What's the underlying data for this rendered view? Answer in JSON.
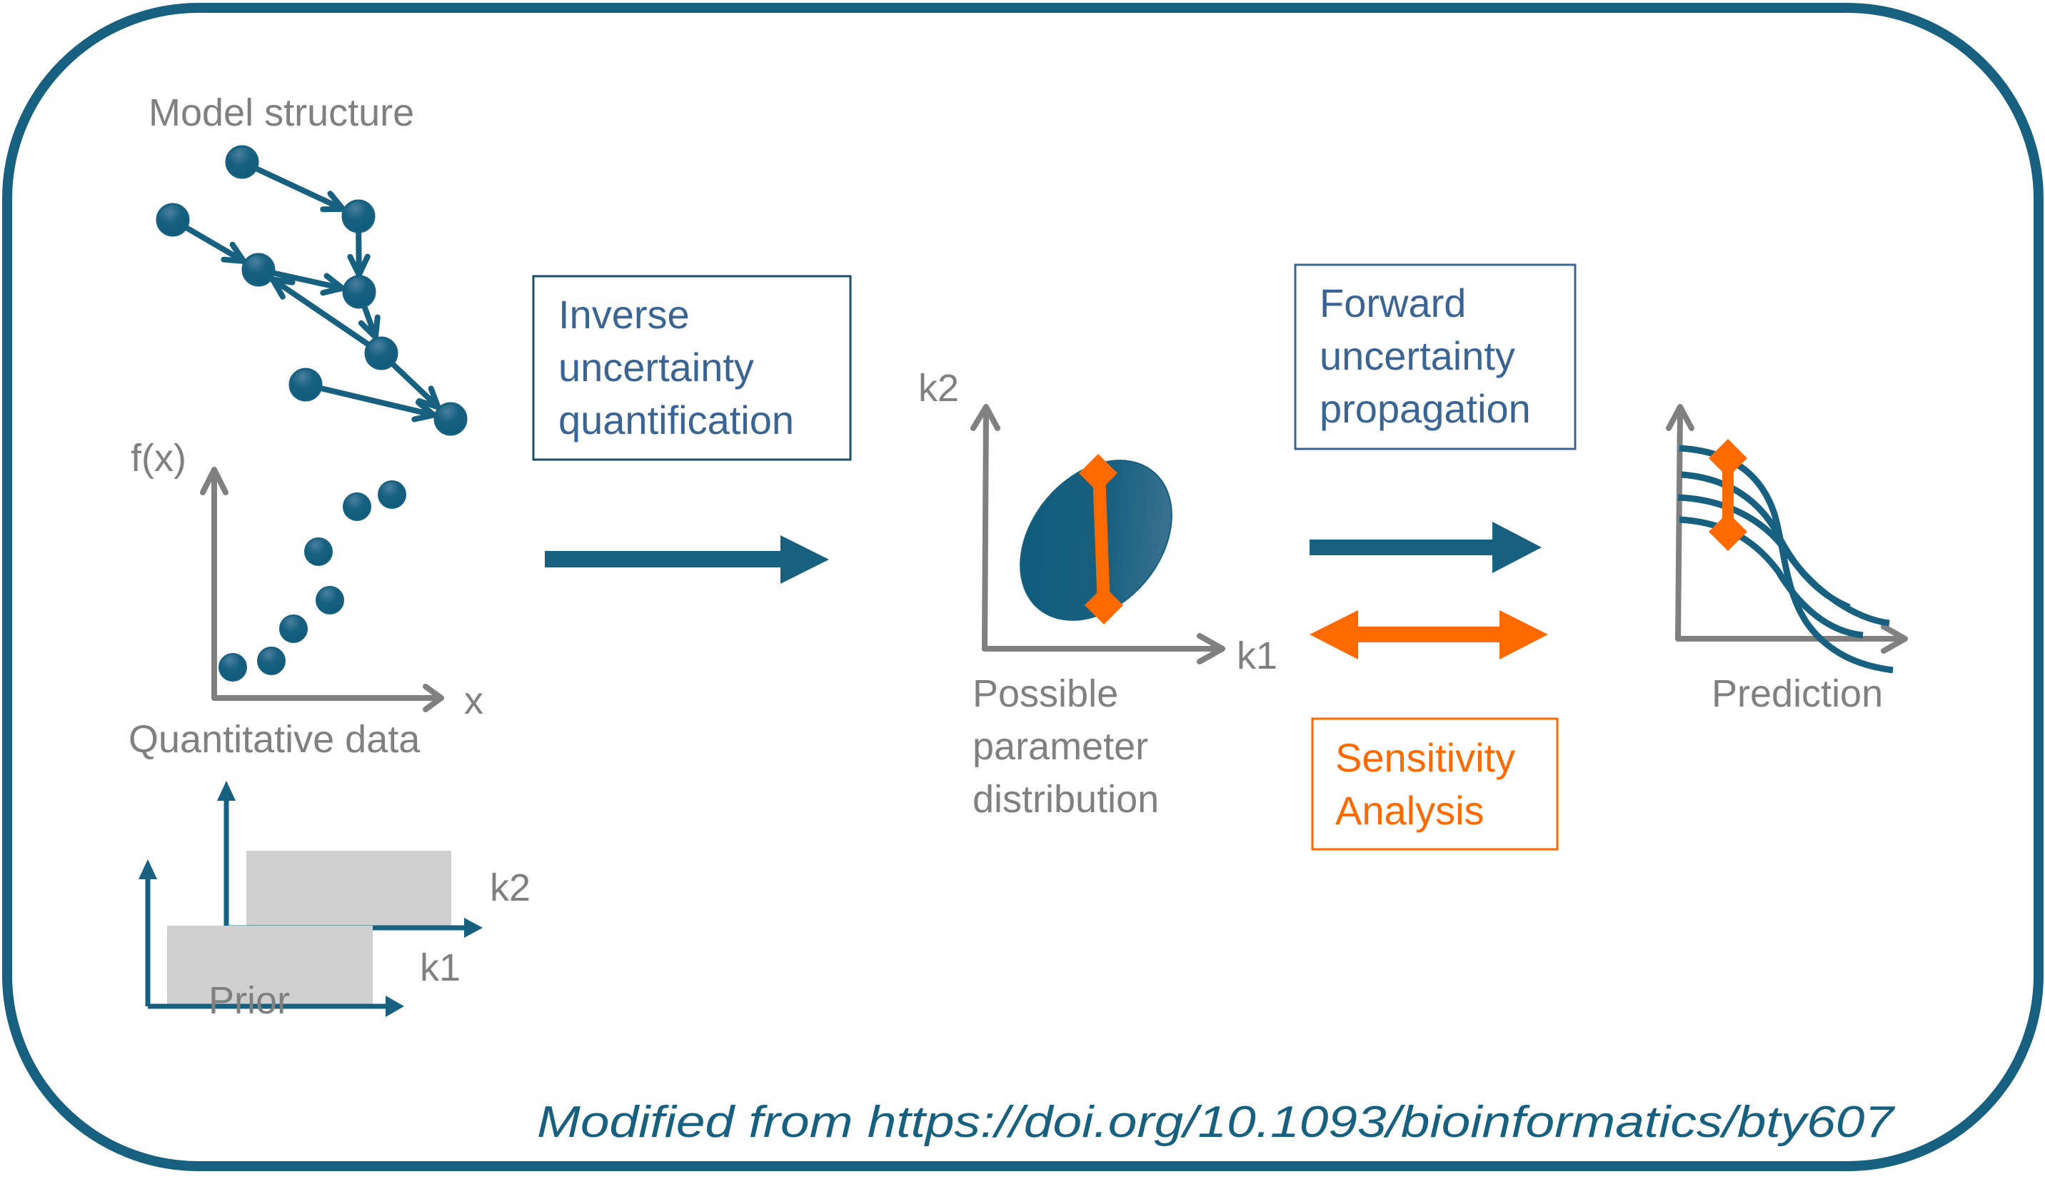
{
  "colors": {
    "primary": "#17607f",
    "accent": "#ff6a00",
    "label_grey": "#808080",
    "box_text_blue": "#3a6494",
    "prior_fill": "#d0d0d0"
  },
  "model_structure": {
    "title": "Model structure",
    "nodes": [
      "A",
      "B",
      "C",
      "D",
      "E",
      "F",
      "G",
      "H"
    ],
    "edges": [
      [
        "A",
        "B"
      ],
      [
        "B",
        "E"
      ],
      [
        "C",
        "D"
      ],
      [
        "D",
        "E"
      ],
      [
        "E",
        "F"
      ],
      [
        "F",
        "D"
      ],
      [
        "F",
        "H"
      ],
      [
        "G",
        "H"
      ]
    ]
  },
  "quantitative_data": {
    "title": "Quantitative data",
    "y_label": "f(x)",
    "x_label": "x",
    "points_count": 7
  },
  "prior": {
    "title": "Prior",
    "axis_labels": [
      "k1",
      "k2"
    ]
  },
  "inverse_box": {
    "lines": [
      "Inverse",
      "uncertainty",
      "quantification"
    ]
  },
  "parameter_distribution": {
    "y_label": "k2",
    "x_label": "k1",
    "caption_lines": [
      "Possible",
      "parameter",
      "distribution"
    ]
  },
  "forward_box": {
    "lines": [
      "Forward",
      "uncertainty",
      "propagation"
    ]
  },
  "sensitivity_box": {
    "lines": [
      "Sensitivity",
      "Analysis"
    ]
  },
  "prediction": {
    "caption": "Prediction",
    "curves_count": 4
  },
  "footer": {
    "citation": "Modified from https://doi.org/10.1093/bioinformatics/bty607"
  }
}
